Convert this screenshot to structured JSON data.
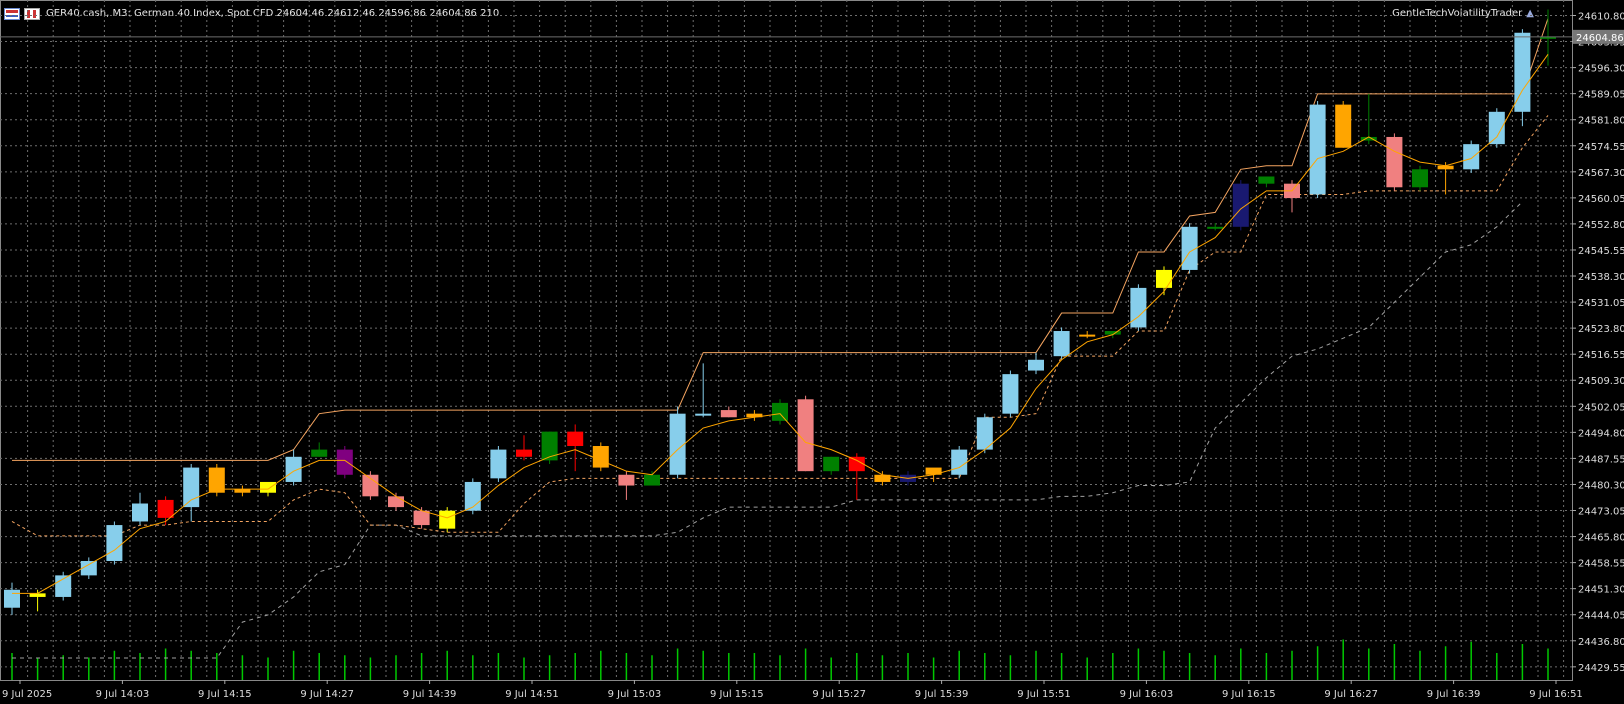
{
  "header": {
    "symbol_info": "GER40.cash, M3:  German 40 Index, Spot CFD  24604.46 24612.46 24596.86 24604.86  210",
    "indicator_name": "GentleTechVolatilityTrader"
  },
  "current_price_label": "24604.86",
  "colors": {
    "background": "#000000",
    "grid": "#6e6e6e",
    "candle_up": "#87ceeb",
    "candle_down": "#f08080",
    "volume": "#00c800",
    "band_line": "#f4a460",
    "mid_line": "#ffa500",
    "trail_line": "#a0a0a0",
    "price_line": "#6e6e6e"
  },
  "chart_data": {
    "type": "candlestick",
    "title": "",
    "y_axis": {
      "min": 24427,
      "max": 24614,
      "ticks": [
        "24610.80",
        "24603.55",
        "24596.30",
        "24589.05",
        "24581.80",
        "24574.55",
        "24567.30",
        "24560.05",
        "24552.80",
        "24545.55",
        "24538.30",
        "24531.05",
        "24523.80",
        "24516.55",
        "24509.30",
        "24502.05",
        "24494.80",
        "24487.55",
        "24480.30",
        "24473.05",
        "24465.80",
        "24458.55",
        "24451.30",
        "24444.05",
        "24436.80",
        "24429.55"
      ]
    },
    "x_axis": {
      "labels": [
        "9 Jul 2025",
        "9 Jul 14:03",
        "9 Jul 14:15",
        "9 Jul 14:27",
        "9 Jul 14:39",
        "9 Jul 14:51",
        "9 Jul 15:03",
        "9 Jul 15:15",
        "9 Jul 15:27",
        "9 Jul 15:39",
        "9 Jul 15:51",
        "9 Jul 16:03",
        "9 Jul 16:15",
        "9 Jul 16:27",
        "9 Jul 16:39",
        "9 Jul 16:51"
      ]
    },
    "candles": [
      {
        "o": 24451,
        "h": 24453,
        "l": 24444,
        "c": 24446,
        "color": "#87ceeb"
      },
      {
        "o": 24449,
        "h": 24451,
        "l": 24445,
        "c": 24450,
        "color": "#ffff00"
      },
      {
        "o": 24449,
        "h": 24456,
        "l": 24448,
        "c": 24455,
        "color": "#87ceeb"
      },
      {
        "o": 24455,
        "h": 24460,
        "l": 24454,
        "c": 24459,
        "color": "#87ceeb"
      },
      {
        "o": 24459,
        "h": 24470,
        "l": 24458,
        "c": 24469,
        "color": "#87ceeb"
      },
      {
        "o": 24470,
        "h": 24478,
        "l": 24469,
        "c": 24475,
        "color": "#87ceeb"
      },
      {
        "o": 24476,
        "h": 24477,
        "l": 24469,
        "c": 24471,
        "color": "#ff0000"
      },
      {
        "o": 24474,
        "h": 24486,
        "l": 24470,
        "c": 24485,
        "color": "#87ceeb"
      },
      {
        "o": 24485,
        "h": 24486,
        "l": 24477,
        "c": 24478,
        "color": "#ffa500"
      },
      {
        "o": 24478,
        "h": 24480,
        "l": 24477,
        "c": 24479,
        "color": "#ffa500"
      },
      {
        "o": 24478,
        "h": 24481,
        "l": 24477,
        "c": 24481,
        "color": "#ffff00"
      },
      {
        "o": 24481,
        "h": 24490,
        "l": 24480,
        "c": 24488,
        "color": "#87ceeb"
      },
      {
        "o": 24488,
        "h": 24492,
        "l": 24488,
        "c": 24490,
        "color": "#008000"
      },
      {
        "o": 24490,
        "h": 24491,
        "l": 24482,
        "c": 24483,
        "color": "#800080"
      },
      {
        "o": 24483,
        "h": 24484,
        "l": 24476,
        "c": 24477,
        "color": "#f08080"
      },
      {
        "o": 24477,
        "h": 24478,
        "l": 24473,
        "c": 24474,
        "color": "#f08080"
      },
      {
        "o": 24473,
        "h": 24474,
        "l": 24468,
        "c": 24469,
        "color": "#f08080"
      },
      {
        "o": 24468,
        "h": 24474,
        "l": 24467,
        "c": 24473,
        "color": "#ffff00"
      },
      {
        "o": 24473,
        "h": 24482,
        "l": 24472,
        "c": 24481,
        "color": "#87ceeb"
      },
      {
        "o": 24482,
        "h": 24491,
        "l": 24481,
        "c": 24490,
        "color": "#87ceeb"
      },
      {
        "o": 24490,
        "h": 24494,
        "l": 24487,
        "c": 24488,
        "color": "#ff0000"
      },
      {
        "o": 24487,
        "h": 24495,
        "l": 24486,
        "c": 24495,
        "color": "#008000"
      },
      {
        "o": 24495,
        "h": 24497,
        "l": 24484,
        "c": 24491,
        "color": "#ff0000"
      },
      {
        "o": 24491,
        "h": 24492,
        "l": 24484,
        "c": 24485,
        "color": "#ffa500"
      },
      {
        "o": 24483,
        "h": 24484,
        "l": 24476,
        "c": 24480,
        "color": "#f08080"
      },
      {
        "o": 24480,
        "h": 24484,
        "l": 24480,
        "c": 24483,
        "color": "#008000"
      },
      {
        "o": 24483,
        "h": 24502,
        "l": 24482,
        "c": 24500,
        "color": "#87ceeb"
      },
      {
        "o": 24500,
        "h": 24514,
        "l": 24499,
        "c": 24500,
        "color": "#87ceeb"
      },
      {
        "o": 24501,
        "h": 24502,
        "l": 24499,
        "c": 24499,
        "color": "#f08080"
      },
      {
        "o": 24499,
        "h": 24501,
        "l": 24498,
        "c": 24500,
        "color": "#ffa500"
      },
      {
        "o": 24498,
        "h": 24504,
        "l": 24497,
        "c": 24503,
        "color": "#008000"
      },
      {
        "o": 24504,
        "h": 24505,
        "l": 24484,
        "c": 24484,
        "color": "#f08080"
      },
      {
        "o": 24484,
        "h": 24488,
        "l": 24483,
        "c": 24488,
        "color": "#008000"
      },
      {
        "o": 24488,
        "h": 24489,
        "l": 24476,
        "c": 24484,
        "color": "#ff0000"
      },
      {
        "o": 24483,
        "h": 24484,
        "l": 24480,
        "c": 24481,
        "color": "#ffa500"
      },
      {
        "o": 24481,
        "h": 24484,
        "l": 24480,
        "c": 24483,
        "color": "#191970"
      },
      {
        "o": 24483,
        "h": 24484,
        "l": 24481,
        "c": 24485,
        "color": "#ffa500"
      },
      {
        "o": 24483,
        "h": 24491,
        "l": 24482,
        "c": 24490,
        "color": "#87ceeb"
      },
      {
        "o": 24490,
        "h": 24500,
        "l": 24489,
        "c": 24499,
        "color": "#87ceeb"
      },
      {
        "o": 24500,
        "h": 24512,
        "l": 24499,
        "c": 24511,
        "color": "#87ceeb"
      },
      {
        "o": 24512,
        "h": 24517,
        "l": 24511,
        "c": 24515,
        "color": "#87ceeb"
      },
      {
        "o": 24516,
        "h": 24524,
        "l": 24515,
        "c": 24523,
        "color": "#87ceeb"
      },
      {
        "o": 24522,
        "h": 24523,
        "l": 24521,
        "c": 24522,
        "color": "#ffa500"
      },
      {
        "o": 24522,
        "h": 24523,
        "l": 24521,
        "c": 24523,
        "color": "#008000"
      },
      {
        "o": 24524,
        "h": 24536,
        "l": 24523,
        "c": 24535,
        "color": "#87ceeb"
      },
      {
        "o": 24535,
        "h": 24541,
        "l": 24533,
        "c": 24540,
        "color": "#ffff00"
      },
      {
        "o": 24540,
        "h": 24553,
        "l": 24539,
        "c": 24552,
        "color": "#87ceeb"
      },
      {
        "o": 24552,
        "h": 24553,
        "l": 24551,
        "c": 24552,
        "color": "#008000"
      },
      {
        "o": 24552,
        "h": 24565,
        "l": 24551,
        "c": 24564,
        "color": "#191970"
      },
      {
        "o": 24564,
        "h": 24566,
        "l": 24563,
        "c": 24566,
        "color": "#008000"
      },
      {
        "o": 24564,
        "h": 24565,
        "l": 24556,
        "c": 24560,
        "color": "#f08080"
      },
      {
        "o": 24561,
        "h": 24587,
        "l": 24560,
        "c": 24586,
        "color": "#87ceeb"
      },
      {
        "o": 24586,
        "h": 24587,
        "l": 24574,
        "c": 24574,
        "color": "#ffa500"
      },
      {
        "o": 24576,
        "h": 24589,
        "l": 24575,
        "c": 24577,
        "color": "#008000"
      },
      {
        "o": 24577,
        "h": 24578,
        "l": 24562,
        "c": 24563,
        "color": "#f08080"
      },
      {
        "o": 24568,
        "h": 24569,
        "l": 24562,
        "c": 24563,
        "color": "#008000"
      },
      {
        "o": 24568,
        "h": 24570,
        "l": 24561,
        "c": 24569,
        "color": "#ffa500"
      },
      {
        "o": 24568,
        "h": 24576,
        "l": 24567,
        "c": 24575,
        "color": "#87ceeb"
      },
      {
        "o": 24575,
        "h": 24585,
        "l": 24574,
        "c": 24584,
        "color": "#87ceeb"
      },
      {
        "o": 24584,
        "h": 24607,
        "l": 24580,
        "c": 24606,
        "color": "#87ceeb"
      },
      {
        "o": 24604.46,
        "h": 24612.46,
        "l": 24596.86,
        "c": 24604.86,
        "color": "#008000"
      }
    ],
    "volume": [
      12,
      10,
      11,
      10,
      13,
      12,
      14,
      13,
      12,
      11,
      10,
      13,
      12,
      11,
      10,
      11,
      12,
      13,
      11,
      12,
      10,
      11,
      12,
      13,
      12,
      11,
      14,
      13,
      12,
      12,
      11,
      14,
      10,
      12,
      11,
      12,
      10,
      13,
      12,
      11,
      13,
      12,
      10,
      12,
      14,
      13,
      12,
      11,
      14,
      12,
      13,
      15,
      18,
      14,
      16,
      13,
      15,
      17,
      12,
      16,
      14
    ],
    "volume_max": 40,
    "band_upper": [
      24487,
      24487,
      24487,
      24487,
      24487,
      24487,
      24487,
      24487,
      24487,
      24487,
      24487,
      24490,
      24500,
      24501,
      24501,
      24501,
      24501,
      24501,
      24501,
      24501,
      24501,
      24501,
      24501,
      24501,
      24501,
      24501,
      24501,
      24517,
      24517,
      24517,
      24517,
      24517,
      24517,
      24517,
      24517,
      24517,
      24517,
      24517,
      24517,
      24517,
      24517,
      24528,
      24528,
      24528,
      24545,
      24545,
      24555,
      24556,
      24568,
      24569,
      24569,
      24589,
      24589,
      24589,
      24589,
      24589,
      24589,
      24589,
      24589,
      24589,
      24610
    ],
    "band_lower": [
      24470,
      24466,
      24466,
      24466,
      24466,
      24469,
      24469,
      24470,
      24470,
      24470,
      24470,
      24476,
      24479,
      24478,
      24469,
      24469,
      24468,
      24467,
      24467,
      24467,
      24475,
      24481,
      24482,
      24482,
      24482,
      24482,
      24482,
      24482,
      24482,
      24482,
      24482,
      24482,
      24482,
      24482,
      24482,
      24482,
      24482,
      24482,
      24499,
      24499,
      24500,
      24516,
      24516,
      24516,
      24523,
      24523,
      24540,
      24545,
      24545,
      24561,
      24561,
      24561,
      24561,
      24562,
      24562,
      24562,
      24562,
      24562,
      24562,
      24574,
      24583
    ],
    "mid_line": [
      24450,
      24450,
      24454,
      24458,
      24462,
      24468,
      24470,
      24476,
      24479,
      24479,
      24479,
      24484,
      24487,
      24487,
      24482,
      24477,
      24473,
      24471,
      24474,
      24480,
      24485,
      24488,
      24490,
      24487,
      24484,
      24483,
      24490,
      24496,
      24498,
      24499,
      24500,
      24492,
      24490,
      24487,
      24483,
      24482,
      24483,
      24485,
      24490,
      24496,
      24507,
      24515,
      24520,
      24522,
      24527,
      24534,
      24545,
      24549,
      24557,
      24562,
      24562,
      24571,
      24573,
      24577,
      24573,
      24570,
      24569,
      24571,
      24577,
      24590,
      24600
    ],
    "trail_line": [
      24432,
      24432,
      24432,
      24432,
      24432,
      24432,
      24432,
      24432,
      24432,
      24442,
      24444,
      24449,
      24456,
      24458,
      24469,
      24469,
      24466,
      24466,
      24466,
      24466,
      24466,
      24466,
      24466,
      24466,
      24466,
      24466,
      24467,
      24471,
      24474,
      24474,
      24474,
      24474,
      24474,
      24476,
      24476,
      24476,
      24476,
      24476,
      24476,
      24476,
      24476,
      24477,
      24477,
      24478,
      24480,
      24480,
      24481,
      24496,
      24503,
      24510,
      24516,
      24518,
      24521,
      24524,
      24531,
      24538,
      24545,
      24547,
      24552,
      24559
    ]
  }
}
